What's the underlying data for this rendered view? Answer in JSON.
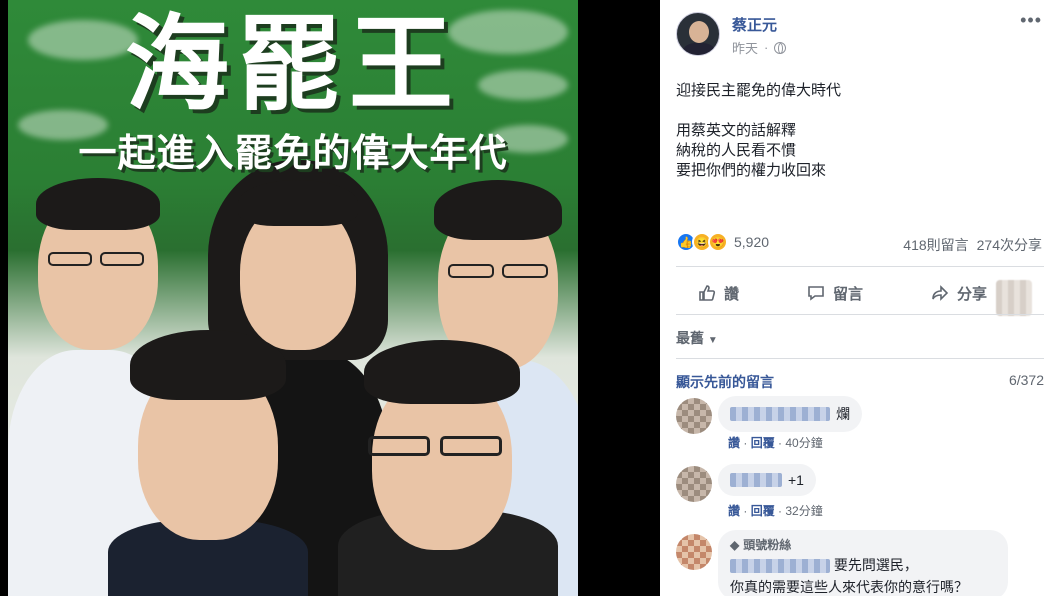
{
  "poster": {
    "title": "海罷王",
    "subtitle": "一起進入罷免的偉大年代"
  },
  "post": {
    "author": "蔡正元",
    "time": "昨天",
    "privacy_icon": "globe-icon",
    "more_icon": "ellipsis-icon",
    "lines": [
      "迎接民主罷免的偉大時代",
      "用蔡英文的話解釋",
      "納稅的人民看不慣",
      "要把你們的權力收回來"
    ],
    "reaction_count": "5,920",
    "comments_count": "418則留言",
    "shares_count": "274次分享",
    "actions": {
      "like": "讚",
      "comment": "留言",
      "share": "分享"
    }
  },
  "comments_section": {
    "sort_label": "最舊",
    "view_previous": "顯示先前的留言",
    "counter": "6/372",
    "comments": [
      {
        "text_suffix": "爛",
        "like": "讚",
        "reply": "回覆",
        "time": "40分鐘"
      },
      {
        "text_suffix": "+1",
        "like": "讚",
        "reply": "回覆",
        "time": "32分鐘"
      },
      {
        "badge": "頭號粉絲",
        "line1": "要先問選民，",
        "line2": "你真的需要這些人來代表你的意行嗎？"
      }
    ]
  },
  "colors": {
    "link": "#385898",
    "like": "#1877f2",
    "poster_green": "#2f8a39"
  }
}
